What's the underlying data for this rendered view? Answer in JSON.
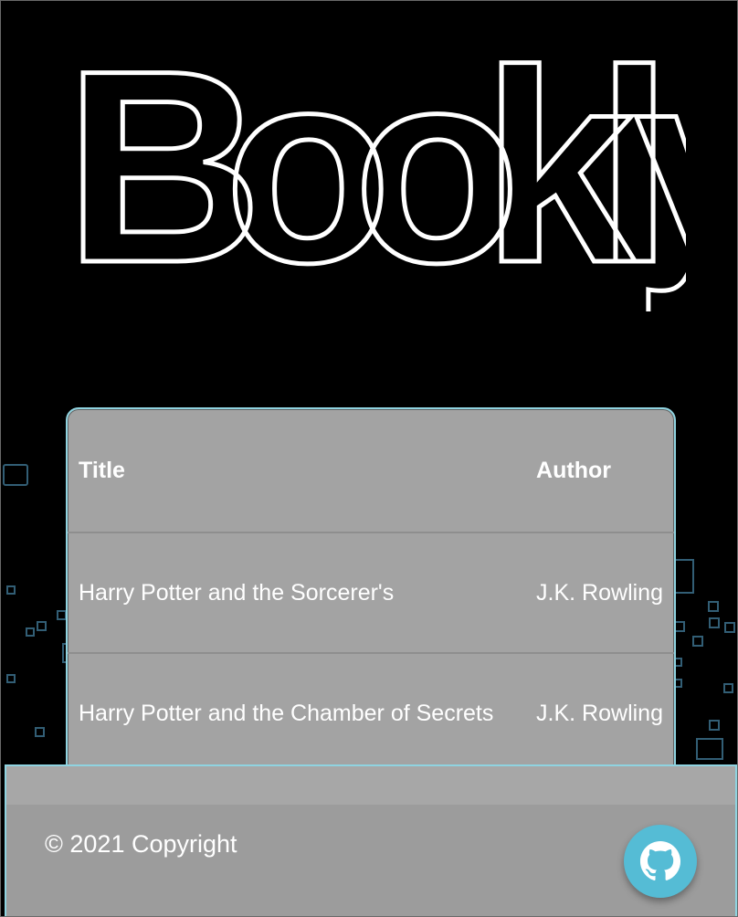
{
  "brand": {
    "logo_text": "Bookly"
  },
  "table": {
    "headers": [
      "Title",
      "Author"
    ],
    "rows": [
      {
        "title": "Harry Potter and the Sorcerer's",
        "author": "J.K. Rowling"
      },
      {
        "title": "Harry Potter and the Chamber of Secrets",
        "author": "J.K. Rowling"
      }
    ]
  },
  "footer": {
    "copyright": "© 2021 Copyright",
    "github_icon": "github-icon"
  },
  "colors": {
    "accent_border": "#8fd3e0",
    "github_button": "#55bcd5",
    "table_background": "#a3a3a3",
    "page_background": "#000000"
  }
}
